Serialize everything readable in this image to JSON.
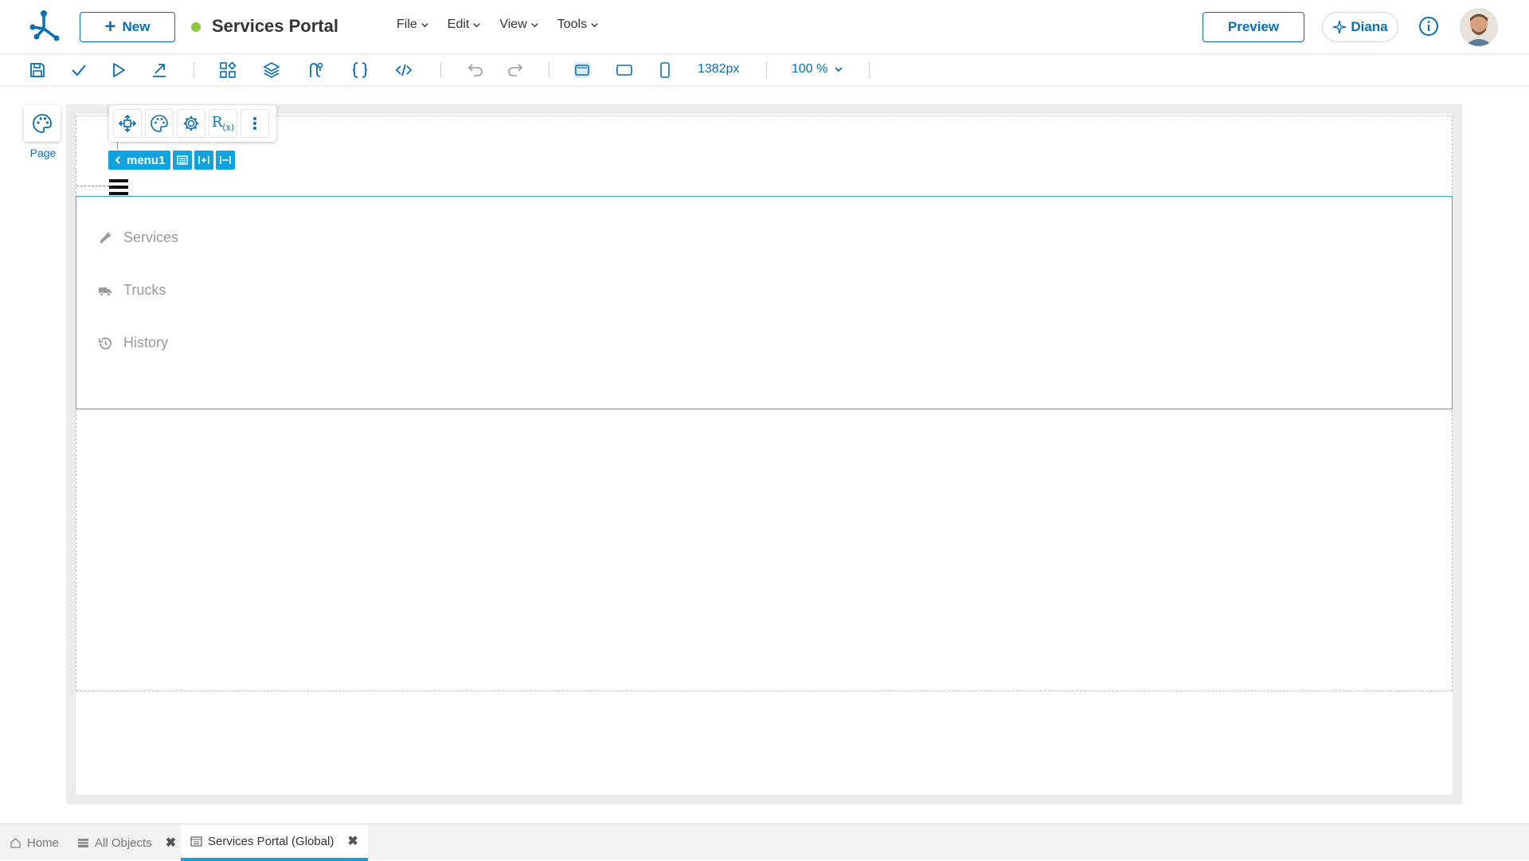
{
  "header": {
    "new_label": "New",
    "app_title": "Services Portal",
    "status_color": "#8dc63f",
    "menu": [
      {
        "label": "File"
      },
      {
        "label": "Edit"
      },
      {
        "label": "View"
      },
      {
        "label": "Tools"
      }
    ],
    "preview_label": "Preview",
    "user_name": "Diana"
  },
  "toolbar": {
    "width_value": "1382px",
    "zoom_value": "100 %"
  },
  "left_rail": {
    "page_label": "Page"
  },
  "selection": {
    "component_name": "menu1"
  },
  "menu_component": {
    "items": [
      {
        "label": "Services",
        "icon": "wrench-icon"
      },
      {
        "label": "Trucks",
        "icon": "truck-icon"
      },
      {
        "label": "History",
        "icon": "history-icon"
      }
    ]
  },
  "bottom_tabs": [
    {
      "label": "Home",
      "icon": "home-icon"
    },
    {
      "label": "All Objects",
      "icon": "list-icon"
    },
    {
      "label": "Services Portal (Global)",
      "icon": "page-icon"
    }
  ],
  "colors": {
    "primary": "#0a6eb4",
    "selection": "#13a3dc"
  }
}
